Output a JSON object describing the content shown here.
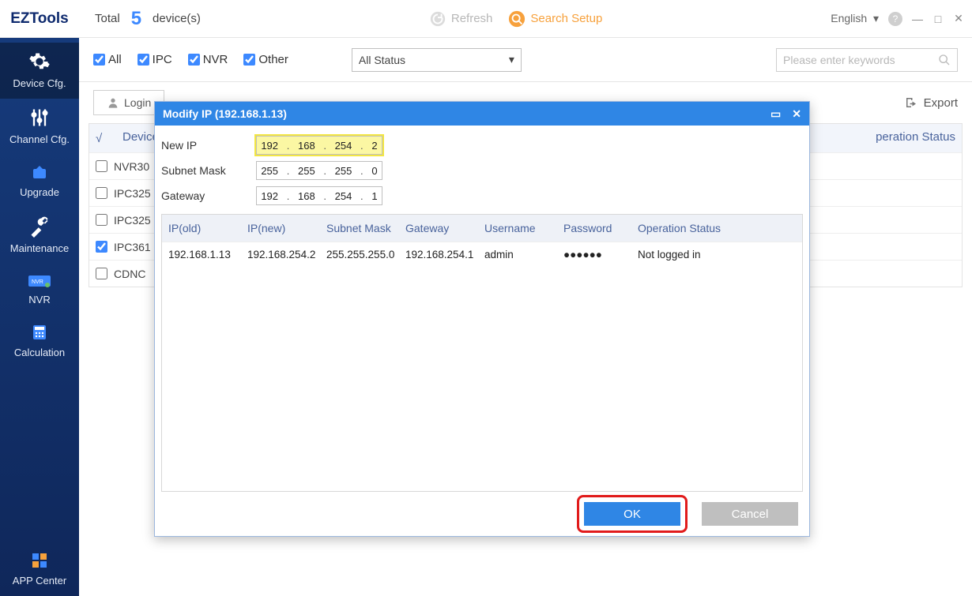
{
  "brand": "EZTools",
  "top": {
    "total_label": "Total",
    "total_count": "5",
    "devices_label": "device(s)",
    "refresh": "Refresh",
    "search_setup": "Search Setup",
    "language": "English"
  },
  "sidebar": {
    "items": [
      {
        "label": "Device Cfg."
      },
      {
        "label": "Channel Cfg."
      },
      {
        "label": "Upgrade"
      },
      {
        "label": "Maintenance"
      },
      {
        "label": "NVR"
      },
      {
        "label": "Calculation"
      }
    ],
    "app_center": "APP Center"
  },
  "filters": {
    "all": "All",
    "ipc": "IPC",
    "nvr": "NVR",
    "other": "Other",
    "status": "All Status",
    "search_placeholder": "Please enter keywords"
  },
  "toolbar": {
    "login": "Login",
    "export": "Export"
  },
  "dev_table": {
    "check_mark": "√",
    "col_name": "Device Name",
    "col_op": "Operation Status",
    "rows": [
      {
        "name": "NVR30",
        "checked": false
      },
      {
        "name": "IPC325",
        "checked": false
      },
      {
        "name": "IPC325",
        "checked": false
      },
      {
        "name": "IPC361",
        "checked": true
      },
      {
        "name": "CDNC",
        "checked": false
      }
    ]
  },
  "modal": {
    "title": "Modify IP (192.168.1.13)",
    "new_ip_label": "New IP",
    "subnet_label": "Subnet Mask",
    "gateway_label": "Gateway",
    "new_ip": [
      "192",
      "168",
      "254",
      "2"
    ],
    "subnet": [
      "255",
      "255",
      "255",
      "0"
    ],
    "gateway": [
      "192",
      "168",
      "254",
      "1"
    ],
    "grid": {
      "headers": {
        "old": "IP(old)",
        "new": "IP(new)",
        "mask": "Subnet Mask",
        "gw": "Gateway",
        "user": "Username",
        "pwd": "Password",
        "stat": "Operation Status"
      },
      "row": {
        "old": "192.168.1.13",
        "new": "192.168.254.2",
        "mask": "255.255.255.0",
        "gw": "192.168.254.1",
        "user": "admin",
        "pwd": "●●●●●●",
        "stat": "Not logged in"
      }
    },
    "ok": "OK",
    "cancel": "Cancel"
  }
}
